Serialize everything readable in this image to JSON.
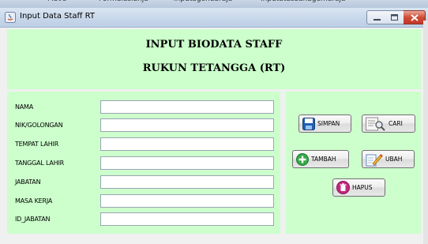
{
  "background_tabs": [
    "Mave",
    "Formulasianja",
    "Inputagendaraja",
    "Inputatasaanagemaraja"
  ],
  "window": {
    "title": "Input Data Staff RT",
    "title_suffix": ""
  },
  "header": {
    "line1": "INPUT BIODATA STAFF",
    "line2": "RUKUN TETANGGA (RT)"
  },
  "form": {
    "fields": [
      {
        "label": "NAMA",
        "value": ""
      },
      {
        "label": "NIK/GOLONGAN",
        "value": ""
      },
      {
        "label": "TEMPAT LAHIR",
        "value": ""
      },
      {
        "label": "TANGGAL LAHIR",
        "value": ""
      },
      {
        "label": "JABATAN",
        "value": ""
      },
      {
        "label": "MASA KERJA",
        "value": ""
      },
      {
        "label": "ID_JABATAN",
        "value": ""
      }
    ]
  },
  "buttons": {
    "simpan": "SIMPAN",
    "cari": "CARI",
    "tambah": "TAMBAH",
    "ubah": "UBAH",
    "hapus": "HAPUS"
  },
  "colors": {
    "panel": "#ccffcc",
    "window_bg": "#f0f0f0",
    "close_button": "#c0392b"
  },
  "icons": {
    "app": "java-icon",
    "simpan": "floppy-disk-icon",
    "cari": "search-document-icon",
    "tambah": "plus-circle-icon",
    "ubah": "edit-pencil-icon",
    "hapus": "trash-icon"
  }
}
